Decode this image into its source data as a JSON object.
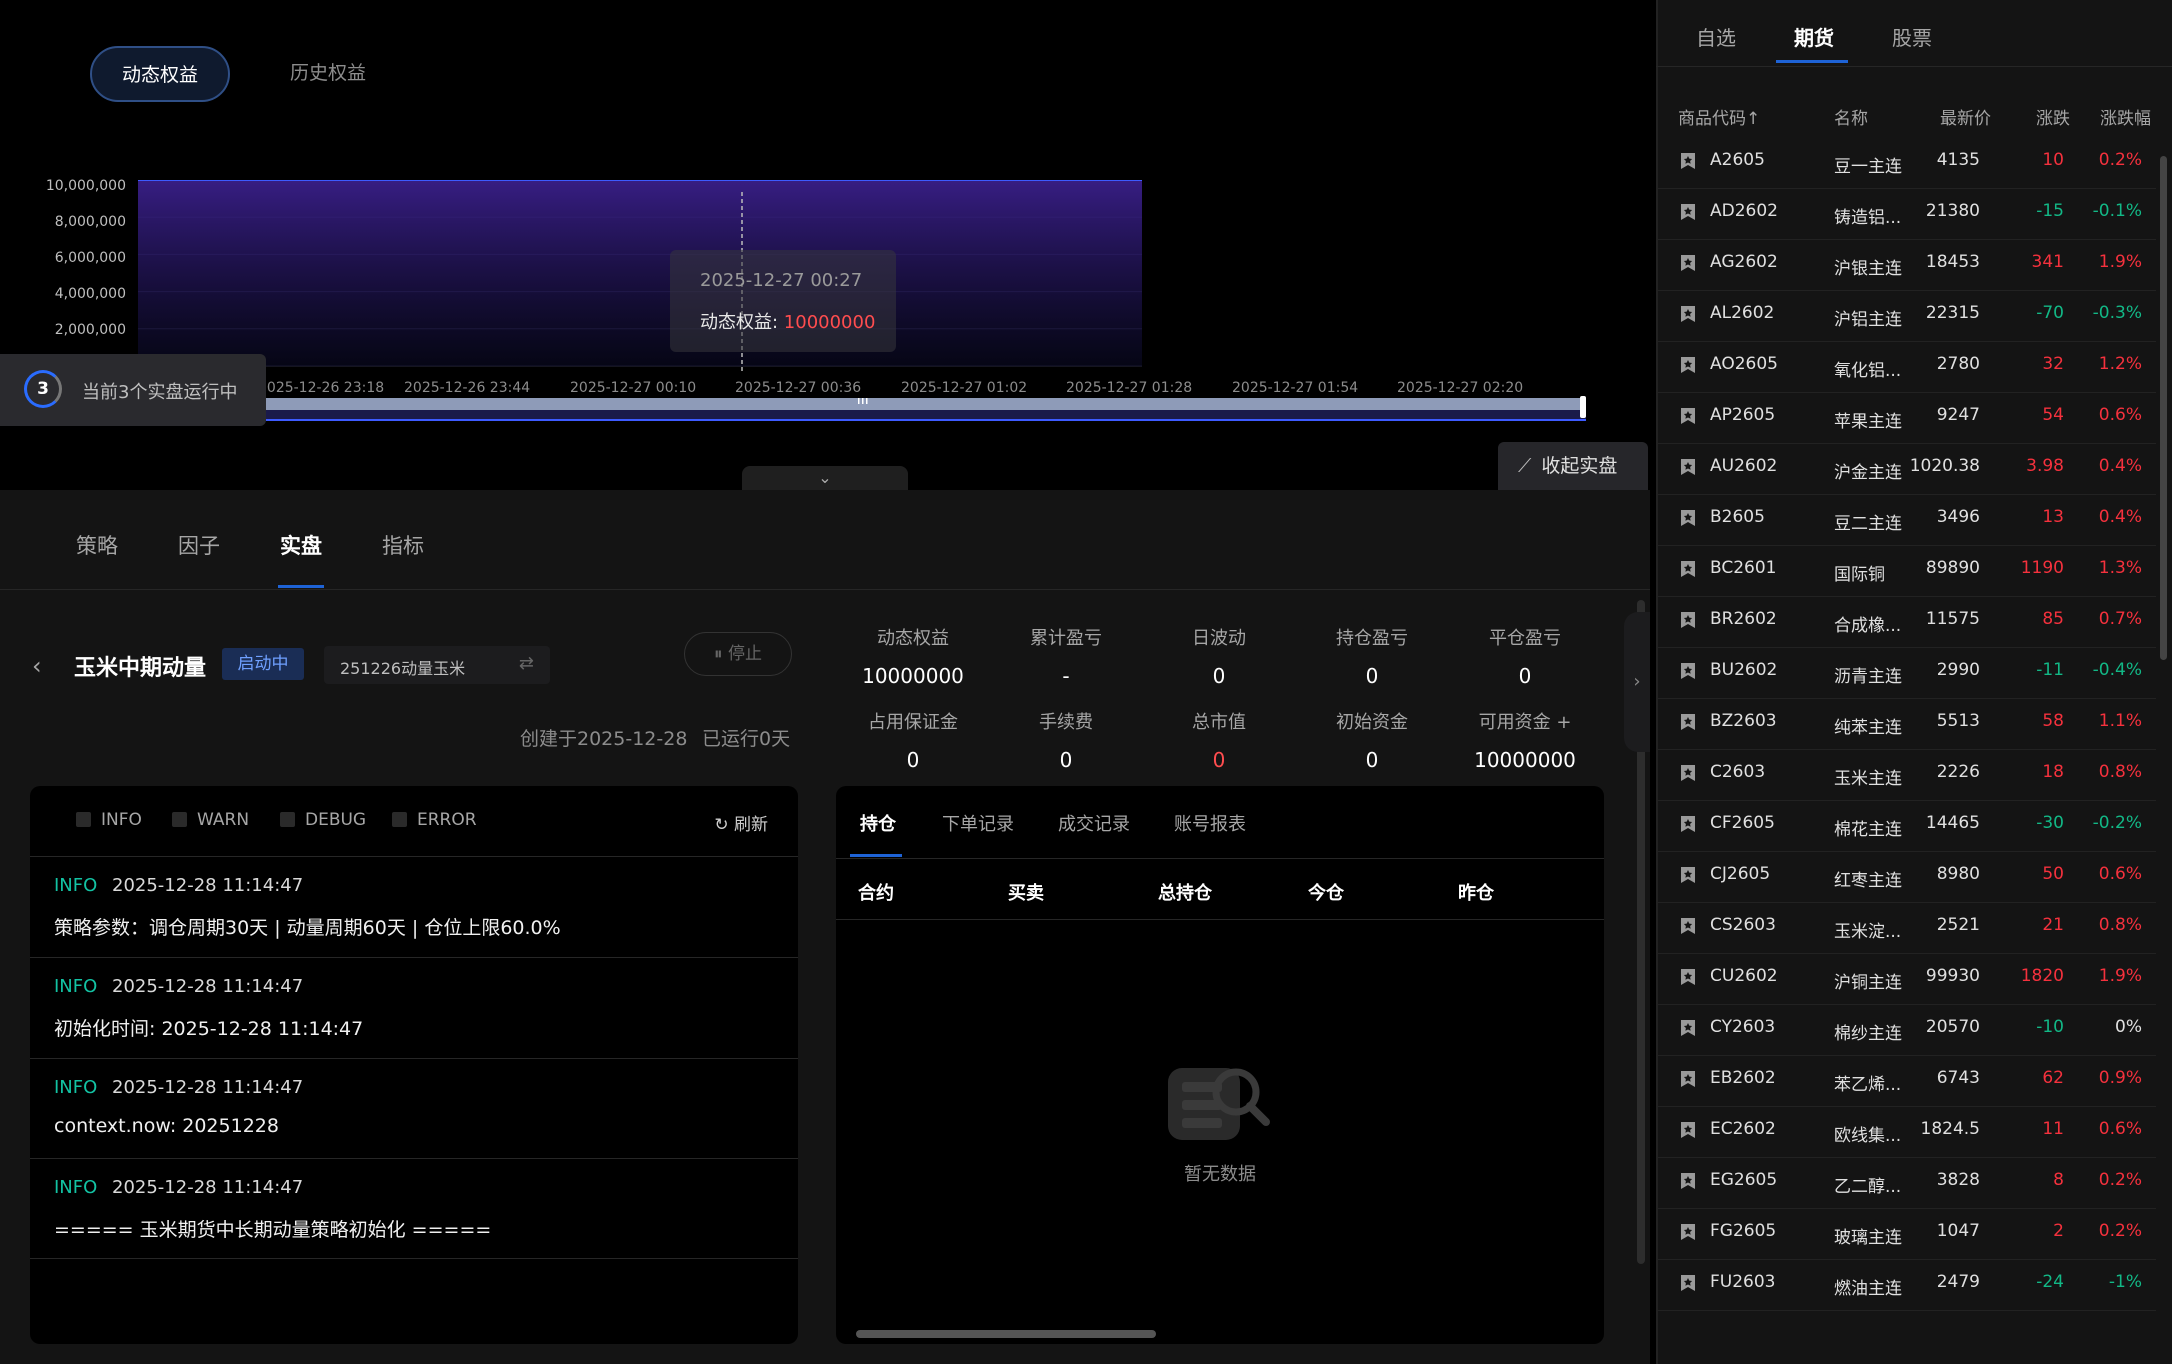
{
  "equity_tabs": {
    "dynamic": "动态权益",
    "history": "历史权益"
  },
  "chart_data": {
    "type": "area",
    "y_ticks": [
      "10,000,000",
      "8,000,000",
      "6,000,000",
      "4,000,000",
      "2,000,000"
    ],
    "x_ticks": [
      "2025-12-26 23:18",
      "2025-12-26 23:44",
      "2025-12-27 00:10",
      "2025-12-27 00:36",
      "2025-12-27 01:02",
      "2025-12-27 01:28",
      "2025-12-27 01:54",
      "2025-12-27 02:20"
    ],
    "ylim": [
      0,
      10000000
    ],
    "series": [
      {
        "values": [
          10000000,
          10000000,
          10000000,
          10000000,
          10000000,
          10000000,
          10000000,
          10000000
        ]
      }
    ],
    "line_color": "#3d5bff",
    "fill_color": "#3a1f8a",
    "tooltip": {
      "date": "2025-12-27 00:27",
      "label": "动态权益: ",
      "value": "10000000"
    }
  },
  "running": {
    "count": "3",
    "text": "当前3个实盘运行中"
  },
  "collect_button": "收起实盘",
  "main_tabs": [
    "策略",
    "因子",
    "实盘",
    "指标"
  ],
  "strategy": {
    "name": "玉米中期动量",
    "status": "启动中",
    "account": "251226动量玉米",
    "stop": "停止",
    "created": "创建于2025-12-28",
    "running_days": "已运行0天"
  },
  "stats": [
    {
      "label": "动态权益",
      "value": "10000000"
    },
    {
      "label": "累计盈亏",
      "value": "-"
    },
    {
      "label": "日波动",
      "value": "0"
    },
    {
      "label": "持仓盈亏",
      "value": "0"
    },
    {
      "label": "平仓盈亏",
      "value": "0"
    },
    {
      "label": "占用保证金",
      "value": "0"
    },
    {
      "label": "手续费",
      "value": "0"
    },
    {
      "label": "总市值",
      "value": "0"
    },
    {
      "label": "初始资金",
      "value": "0"
    },
    {
      "label": "可用资金 +",
      "value": "10000000"
    }
  ],
  "log": {
    "filters": [
      "INFO",
      "WARN",
      "DEBUG",
      "ERROR"
    ],
    "refresh": "刷新",
    "entries": [
      {
        "level": "INFO",
        "time": "2025-12-28 11:14:47",
        "message": "策略参数：调仓周期30天 | 动量周期60天 | 仓位上限60.0%"
      },
      {
        "level": "INFO",
        "time": "2025-12-28 11:14:47",
        "message": "初始化时间: 2025-12-28 11:14:47"
      },
      {
        "level": "INFO",
        "time": "2025-12-28 11:14:47",
        "message": "context.now: 20251228"
      },
      {
        "level": "INFO",
        "time": "2025-12-28 11:14:47",
        "message": "===== 玉米期货中长期动量策略初始化 ====="
      }
    ]
  },
  "positions": {
    "tabs": [
      "持仓",
      "下单记录",
      "成交记录",
      "账号报表"
    ],
    "columns": [
      "合约",
      "买卖",
      "总持仓",
      "今仓",
      "昨仓"
    ],
    "empty": "暂无数据"
  },
  "market": {
    "tabs": [
      "自选",
      "期货",
      "股票"
    ],
    "headers": [
      "商品代码↑",
      "名称",
      "最新价",
      "涨跌",
      "涨跌幅"
    ],
    "rows": [
      {
        "code": "A2605",
        "name": "豆一主连",
        "price": "4135",
        "chg": "10",
        "pct": "0.2%",
        "dir": "up"
      },
      {
        "code": "AD2602",
        "name": "铸造铝...",
        "price": "21380",
        "chg": "-15",
        "pct": "-0.1%",
        "dir": "down"
      },
      {
        "code": "AG2602",
        "name": "沪银主连",
        "price": "18453",
        "chg": "341",
        "pct": "1.9%",
        "dir": "up"
      },
      {
        "code": "AL2602",
        "name": "沪铝主连",
        "price": "22315",
        "chg": "-70",
        "pct": "-0.3%",
        "dir": "down"
      },
      {
        "code": "AO2605",
        "name": "氧化铝...",
        "price": "2780",
        "chg": "32",
        "pct": "1.2%",
        "dir": "up"
      },
      {
        "code": "AP2605",
        "name": "苹果主连",
        "price": "9247",
        "chg": "54",
        "pct": "0.6%",
        "dir": "up"
      },
      {
        "code": "AU2602",
        "name": "沪金主连",
        "price": "1020.38",
        "chg": "3.98",
        "pct": "0.4%",
        "dir": "up"
      },
      {
        "code": "B2605",
        "name": "豆二主连",
        "price": "3496",
        "chg": "13",
        "pct": "0.4%",
        "dir": "up"
      },
      {
        "code": "BC2601",
        "name": "国际铜",
        "price": "89890",
        "chg": "1190",
        "pct": "1.3%",
        "dir": "up"
      },
      {
        "code": "BR2602",
        "name": "合成橡...",
        "price": "11575",
        "chg": "85",
        "pct": "0.7%",
        "dir": "up"
      },
      {
        "code": "BU2602",
        "name": "沥青主连",
        "price": "2990",
        "chg": "-11",
        "pct": "-0.4%",
        "dir": "down"
      },
      {
        "code": "BZ2603",
        "name": "纯苯主连",
        "price": "5513",
        "chg": "58",
        "pct": "1.1%",
        "dir": "up"
      },
      {
        "code": "C2603",
        "name": "玉米主连",
        "price": "2226",
        "chg": "18",
        "pct": "0.8%",
        "dir": "up"
      },
      {
        "code": "CF2605",
        "name": "棉花主连",
        "price": "14465",
        "chg": "-30",
        "pct": "-0.2%",
        "dir": "down"
      },
      {
        "code": "CJ2605",
        "name": "红枣主连",
        "price": "8980",
        "chg": "50",
        "pct": "0.6%",
        "dir": "up"
      },
      {
        "code": "CS2603",
        "name": "玉米淀...",
        "price": "2521",
        "chg": "21",
        "pct": "0.8%",
        "dir": "up"
      },
      {
        "code": "CU2602",
        "name": "沪铜主连",
        "price": "99930",
        "chg": "1820",
        "pct": "1.9%",
        "dir": "up"
      },
      {
        "code": "CY2603",
        "name": "棉纱主连",
        "price": "20570",
        "chg": "-10",
        "pct": "0%",
        "dir": "down"
      },
      {
        "code": "EB2602",
        "name": "苯乙烯...",
        "price": "6743",
        "chg": "62",
        "pct": "0.9%",
        "dir": "up"
      },
      {
        "code": "EC2602",
        "name": "欧线集...",
        "price": "1824.5",
        "chg": "11",
        "pct": "0.6%",
        "dir": "up"
      },
      {
        "code": "EG2605",
        "name": "乙二醇...",
        "price": "3828",
        "chg": "8",
        "pct": "0.2%",
        "dir": "up"
      },
      {
        "code": "FG2605",
        "name": "玻璃主连",
        "price": "1047",
        "chg": "2",
        "pct": "0.2%",
        "dir": "up"
      },
      {
        "code": "FU2603",
        "name": "燃油主连",
        "price": "2479",
        "chg": "-24",
        "pct": "-1%",
        "dir": "down"
      }
    ]
  }
}
